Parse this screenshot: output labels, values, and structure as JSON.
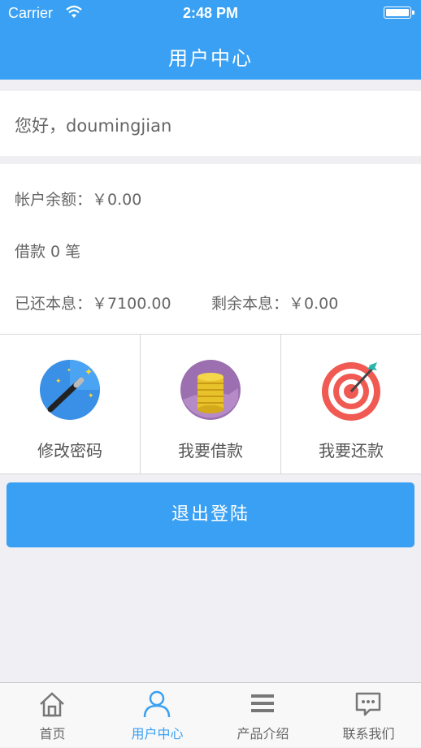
{
  "status_bar": {
    "carrier": "Carrier",
    "time": "2:48 PM"
  },
  "nav": {
    "title": "用户中心"
  },
  "greeting": "您好，doumingjian",
  "account": {
    "balance": "帐户余额：￥0.00",
    "loans": "借款 0 笔",
    "repaid": "已还本息：￥7100.00",
    "remaining": "剩余本息：￥0.00"
  },
  "actions": [
    {
      "label": "修改密码",
      "icon": "magic-wand-icon"
    },
    {
      "label": "我要借款",
      "icon": "coins-icon"
    },
    {
      "label": "我要还款",
      "icon": "target-icon"
    }
  ],
  "logout_label": "退出登陆",
  "tabs": [
    {
      "label": "首页",
      "icon": "home-icon",
      "active": false
    },
    {
      "label": "用户中心",
      "icon": "user-icon",
      "active": true
    },
    {
      "label": "产品介绍",
      "icon": "menu-icon",
      "active": false
    },
    {
      "label": "联系我们",
      "icon": "chat-icon",
      "active": false
    }
  ],
  "colors": {
    "primary": "#3aa0f3",
    "background": "#efeff4"
  }
}
